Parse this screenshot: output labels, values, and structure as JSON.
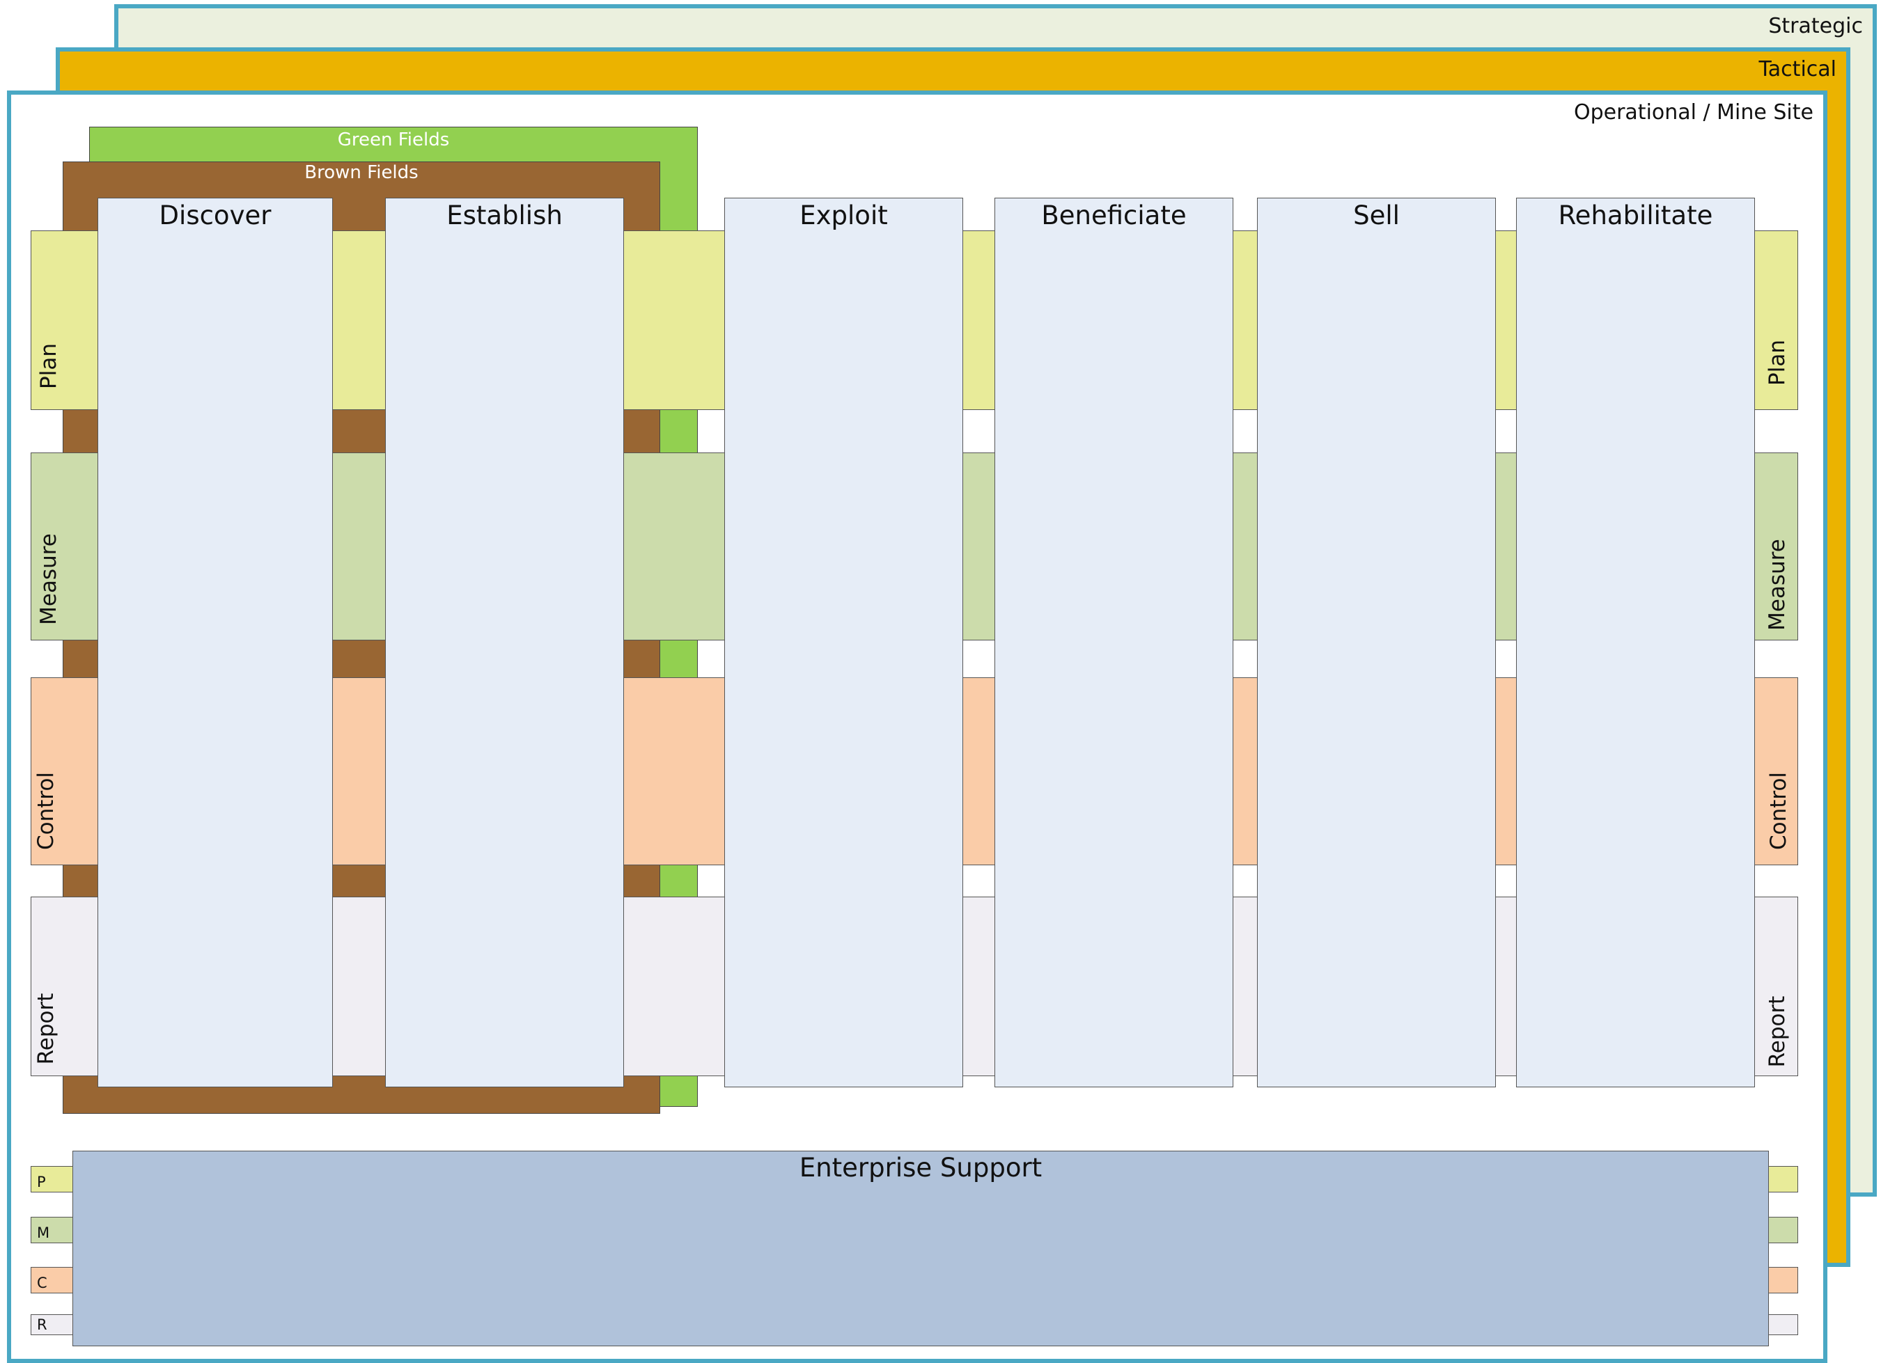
{
  "layers": {
    "strategic": "Strategic",
    "tactical": "Tactical",
    "operational": "Operational / Mine Site"
  },
  "fields": {
    "green": "Green Fields",
    "brown": "Brown Fields"
  },
  "phases": [
    "Discover",
    "Establish",
    "Exploit",
    "Beneficiate",
    "Sell",
    "Rehabilitate"
  ],
  "bands": {
    "plan": "Plan",
    "measure": "Measure",
    "control": "Control",
    "report": "Report"
  },
  "enterprise": {
    "title": "Enterprise Support",
    "bands": {
      "p": "P",
      "m": "M",
      "c": "C",
      "r": "R"
    }
  },
  "colors": {
    "layer_border": "#4aa8c4",
    "strategic_fill": "#ebf0de",
    "tactical_fill": "#ebb300",
    "green_fields": "#92d050",
    "brown_fields": "#996633",
    "plan": "#e8eb99",
    "measure": "#ccdcab",
    "control": "#facca8",
    "report": "#f0eef3",
    "phase": "#e6edf7",
    "enterprise": "#b0c2da"
  }
}
